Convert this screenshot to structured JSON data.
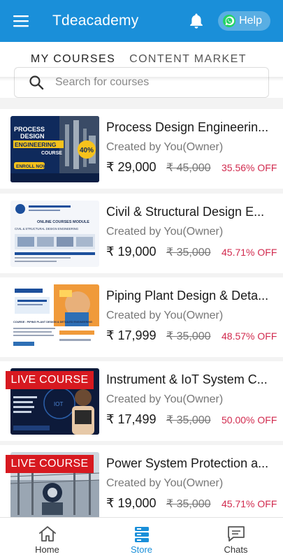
{
  "header": {
    "title": "Tdeacademy",
    "help_label": "Help",
    "menu_icon": "hamburger-menu-icon",
    "bell_icon": "notification-bell-icon",
    "help_icon": "whatsapp-icon"
  },
  "colors": {
    "primary": "#1a8fd9",
    "discount": "#d12a4e",
    "live_badge": "#d71920"
  },
  "tabs": [
    {
      "label": "MY COURSES",
      "active": true
    },
    {
      "label": "CONTENT MARKET",
      "active": false
    }
  ],
  "search": {
    "placeholder": "Search for courses",
    "value": ""
  },
  "courses": [
    {
      "title": "Process Design Engineerin...",
      "created_by": "Created by You(Owner)",
      "price": "₹ 29,000",
      "original_price": "₹ 45,000",
      "discount": "35.56% OFF",
      "live": false
    },
    {
      "title": "Civil & Structural Design E...",
      "created_by": "Created by You(Owner)",
      "price": "₹ 19,000",
      "original_price": "₹ 35,000",
      "discount": "45.71% OFF",
      "live": false
    },
    {
      "title": "Piping Plant Design & Deta...",
      "created_by": "Created by You(Owner)",
      "price": "₹ 17,999",
      "original_price": "₹ 35,000",
      "discount": "48.57% OFF",
      "live": false
    },
    {
      "title": "Instrument & IoT System C...",
      "created_by": "Created by You(Owner)",
      "price": "₹ 17,499",
      "original_price": "₹ 35,000",
      "discount": "50.00% OFF",
      "live": true,
      "live_label": "LIVE COURSE"
    },
    {
      "title": "Power System Protection a...",
      "created_by": "Created by You(Owner)",
      "price": "₹ 19,000",
      "original_price": "₹ 35,000",
      "discount": "45.71% OFF",
      "live": true,
      "live_label": "LIVE COURSE"
    }
  ],
  "thumbs": {
    "t1": {
      "line1": "PROCESS",
      "line2": "DESIGN",
      "line3": "ENGINEERING",
      "line4": "COURSE",
      "badge": "40%",
      "enroll": "ENROLL NOW"
    },
    "t2": {
      "caption": "ONLINE COURSES MODULE",
      "sub": "CIVIL & STRUCTURAL DESIGN ENGINEERING"
    },
    "t3": {
      "caption": "COURSE : PIPING PLANT DESIGN & DETAILED ENGINEERING"
    },
    "t4": {
      "caption": "IOT"
    },
    "t5": {
      "caption": ""
    }
  },
  "bottom_nav": [
    {
      "label": "Home",
      "icon": "home-icon",
      "active": false
    },
    {
      "label": "Store",
      "icon": "store-icon",
      "active": true
    },
    {
      "label": "Chats",
      "icon": "chat-icon",
      "active": false
    }
  ]
}
